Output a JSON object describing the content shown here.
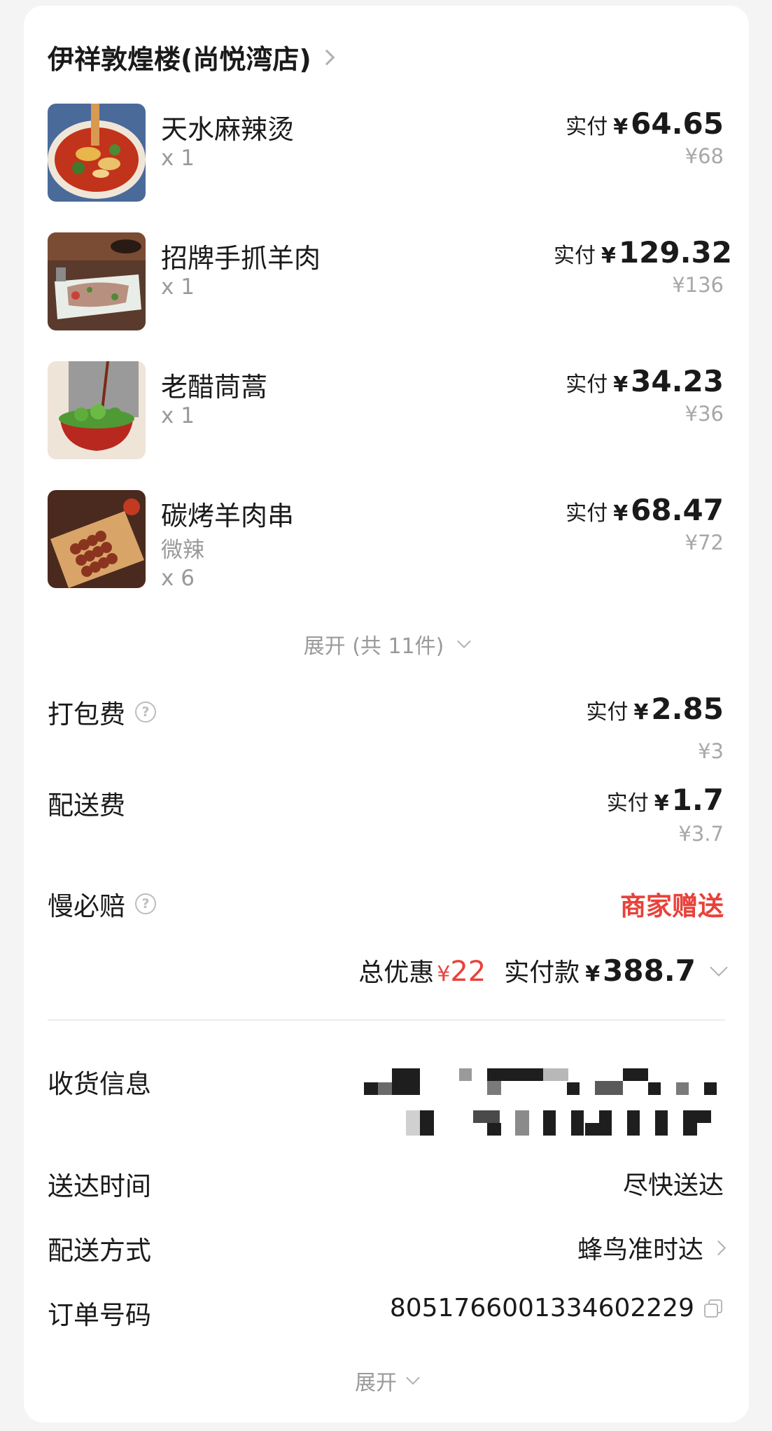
{
  "shop": {
    "name": "伊祥敦煌楼(尚悦湾店)"
  },
  "items": [
    {
      "name": "天水麻辣烫",
      "spec": "",
      "qty": "x 1",
      "paid_label": "实付",
      "currency": "¥",
      "paid": "64.65",
      "original": "¥68",
      "image_icon": "spicy-hotpot-food-image"
    },
    {
      "name": "招牌手抓羊肉",
      "spec": "",
      "qty": "x 1",
      "paid_label": "实付",
      "currency": "¥",
      "paid": "129.32",
      "original": "¥136",
      "image_icon": "lamb-platter-food-image"
    },
    {
      "name": "老醋茼蒿",
      "spec": "",
      "qty": "x 1",
      "paid_label": "实付",
      "currency": "¥",
      "paid": "34.23",
      "original": "¥36",
      "image_icon": "vinegar-greens-food-image"
    },
    {
      "name": "碳烤羊肉串",
      "spec": "微辣",
      "qty": "x 6",
      "paid_label": "实付",
      "currency": "¥",
      "paid": "68.47",
      "original": "¥72",
      "image_icon": "lamb-skewers-food-image"
    }
  ],
  "expand_items": {
    "label": "展开 (共 11件)"
  },
  "fees": {
    "packing": {
      "label": "打包费",
      "paid_label": "实付",
      "currency": "¥",
      "paid": "2.85",
      "original": "¥3"
    },
    "delivery": {
      "label": "配送费",
      "paid_label": "实付",
      "currency": "¥",
      "paid": "1.7",
      "original": "¥3.7"
    },
    "late_comp": {
      "label": "慢必赔",
      "value": "商家赠送"
    }
  },
  "summary": {
    "discount_label": "总优惠",
    "discount_currency": "¥",
    "discount_amount": "22",
    "paid_label": "实付款",
    "paid_currency": "¥",
    "paid_amount": "388.7"
  },
  "info": {
    "address_label": "收货信息",
    "time_label": "送达时间",
    "time_value": "尽快送达",
    "method_label": "配送方式",
    "method_value": "蜂鸟准时达",
    "order_label": "订单号码",
    "order_value": "8051766001334602229"
  },
  "expand_more": {
    "label": "展开"
  },
  "colors": {
    "accent_red": "#e8423a",
    "muted": "#9a9a9a",
    "background": "#f4f4f4"
  }
}
